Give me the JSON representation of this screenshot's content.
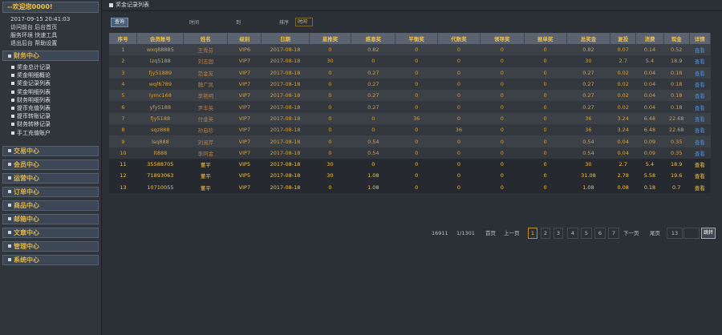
{
  "sidebar": {
    "welcome": "--欢迎您0000!",
    "info": [
      "2017-09-15 20:41:03",
      "访问前台 后台首页",
      "服务环境 快速工具",
      "退出后台 帮助设置"
    ],
    "sections": [
      {
        "label": "财务中心",
        "items": [
          "奖金总计记录",
          "奖金明细概论",
          "奖金记录列表",
          "奖金明细列表",
          "财务明细列表",
          "提币充值列表",
          "提币转账记录",
          "财务转移记录",
          "手工充值账户"
        ]
      },
      {
        "label": "交易中心"
      },
      {
        "label": "会员中心"
      },
      {
        "label": "运营中心"
      },
      {
        "label": "订单中心"
      },
      {
        "label": "商品中心"
      },
      {
        "label": "邮箱中心"
      },
      {
        "label": "文章中心"
      },
      {
        "label": "管理中心"
      },
      {
        "label": "系统中心"
      }
    ]
  },
  "main": {
    "title": "奖金记录列表",
    "filter": {
      "search_label": "查询",
      "time_label": "时间",
      "to_label": "到",
      "sort_label": "排序",
      "sort_value": "时间"
    },
    "columns": [
      "序号",
      "会员账号",
      "姓名",
      "级别",
      "日期",
      "直推奖",
      "感恩奖",
      "平衡奖",
      "代数奖",
      "领导奖",
      "报单奖",
      "总奖金",
      "复投",
      "消费",
      "现金",
      "详情"
    ],
    "rows": [
      [
        "1",
        "wxq88885",
        "王秀芬",
        "VIP6",
        "2017-08-18",
        "0",
        "0.82",
        "0",
        "0",
        "0",
        "0",
        "0.82",
        "0.07",
        "0.14",
        "0.52",
        "查看"
      ],
      [
        "2",
        "lzq5188",
        "刘志国",
        "VIP7",
        "2017-08-18",
        "30",
        "0",
        "0",
        "0",
        "0",
        "0",
        "30",
        "2.7",
        "5.4",
        "18.9",
        "查看"
      ],
      [
        "3",
        "fjy51889",
        "范金友",
        "VIP7",
        "2017-08-18",
        "0",
        "0.27",
        "0",
        "0",
        "0",
        "0",
        "0.27",
        "0.02",
        "0.04",
        "0.18",
        "查看"
      ],
      [
        "4",
        "wqf6789",
        "魏广风",
        "VIP7",
        "2017-08-18",
        "0",
        "0.27",
        "0",
        "0",
        "0",
        "0",
        "0.27",
        "0.02",
        "0.04",
        "0.18",
        "查看"
      ],
      [
        "5",
        "lymc168",
        "李艳明",
        "VIP7",
        "2017-08-18",
        "0",
        "0.27",
        "0",
        "0",
        "0",
        "0",
        "0.27",
        "0.02",
        "0.04",
        "0.18",
        "查看"
      ],
      [
        "6",
        "yfy5188",
        "尹丰英",
        "VIP7",
        "2017-08-18",
        "0",
        "0.27",
        "0",
        "0",
        "0",
        "0",
        "0.27",
        "0.02",
        "0.04",
        "0.18",
        "查看"
      ],
      [
        "7",
        "fjy5188",
        "付金英",
        "VIP7",
        "2017-08-18",
        "0",
        "0",
        "36",
        "0",
        "0",
        "0",
        "36",
        "3.24",
        "6.48",
        "22.68",
        "查看"
      ],
      [
        "8",
        "sqz888",
        "孙启珍",
        "VIP7",
        "2017-08-18",
        "0",
        "0",
        "0",
        "36",
        "0",
        "0",
        "36",
        "3.24",
        "6.48",
        "22.68",
        "查看"
      ],
      [
        "9",
        "lsq888",
        "刘淑芹",
        "VIP7",
        "2017-08-18",
        "0",
        "0.54",
        "0",
        "0",
        "0",
        "0",
        "0.54",
        "0.04",
        "0.09",
        "0.35",
        "查看"
      ],
      [
        "10",
        "lt888",
        "李阿金",
        "VIP7",
        "2017-08-18",
        "0",
        "0.54",
        "0",
        "0",
        "0",
        "0",
        "0.54",
        "0.04",
        "0.09",
        "0.35",
        "查看"
      ],
      [
        "11",
        "35588705",
        "董平",
        "VIP5",
        "2017-08-18",
        "30",
        "0",
        "0",
        "0",
        "0",
        "0",
        "30",
        "2.7",
        "5.4",
        "18.9",
        "查看"
      ],
      [
        "12",
        "71893063",
        "董平",
        "VIP5",
        "2017-08-18",
        "30",
        "1.08",
        "0",
        "0",
        "0",
        "0",
        "31.08",
        "2.78",
        "5.58",
        "19.6",
        "查看"
      ],
      [
        "13",
        "10710055",
        "董平",
        "VIP7",
        "2017-08-18",
        "0",
        "1.08",
        "0",
        "0",
        "0",
        "0",
        "1.08",
        "0.08",
        "0.18",
        "0.7",
        "查看"
      ]
    ],
    "pager": {
      "total": "16911",
      "pages": "1/1301",
      "first": "首页",
      "prev": "上一页",
      "nums": [
        "1",
        "2",
        "3",
        "4",
        "5",
        "6",
        "7"
      ],
      "next": "下一页",
      "last": "尾页",
      "goto_value": "13",
      "jump": "跳转"
    }
  }
}
